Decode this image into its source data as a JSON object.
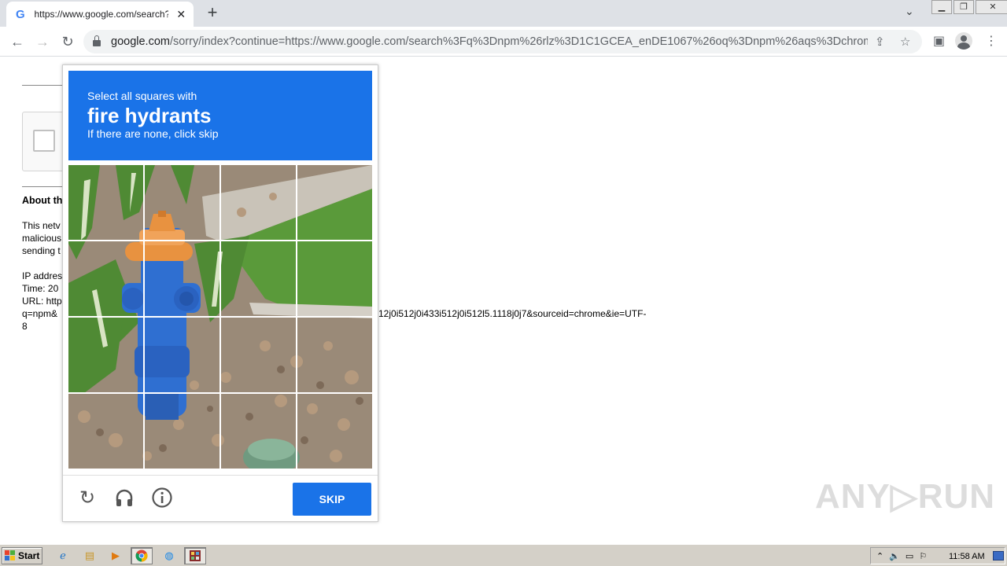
{
  "browser": {
    "tab_title": "https://www.google.com/search?q=",
    "tab_favicon": "G",
    "tab_close": "✕",
    "new_tab": "+",
    "url_host": "google.com",
    "url_path": "/sorry/index?continue=https://www.google.com/search%3Fq%3Dnpm%26rlz%3D1C1GCEA_enDE1067%26oq%3Dnpm%26aqs%3Dchrom..."
  },
  "page": {
    "about_heading": "About th",
    "lines": [
      "This netv",
      "malicious",
      "sending t",
      "IP addres",
      "Time: 20",
      "URL: http",
      "q=npm&",
      "8"
    ],
    "url_tail": "12j0i512j0i433i512j0i512l5.1118j0j7&sourceid=chrome&ie=UTF-"
  },
  "challenge": {
    "subtitle": "Select all squares with",
    "target": "fire hydrants",
    "hint": "If there are none, click skip",
    "skip_label": "SKIP"
  },
  "watermark": "ANY▷RUN",
  "taskbar": {
    "start_label": "Start",
    "clock": "11:58 AM"
  },
  "colors": {
    "accent": "#1a73e8",
    "hydrant_body": "#2f6fd1",
    "hydrant_cap": "#e89240"
  }
}
